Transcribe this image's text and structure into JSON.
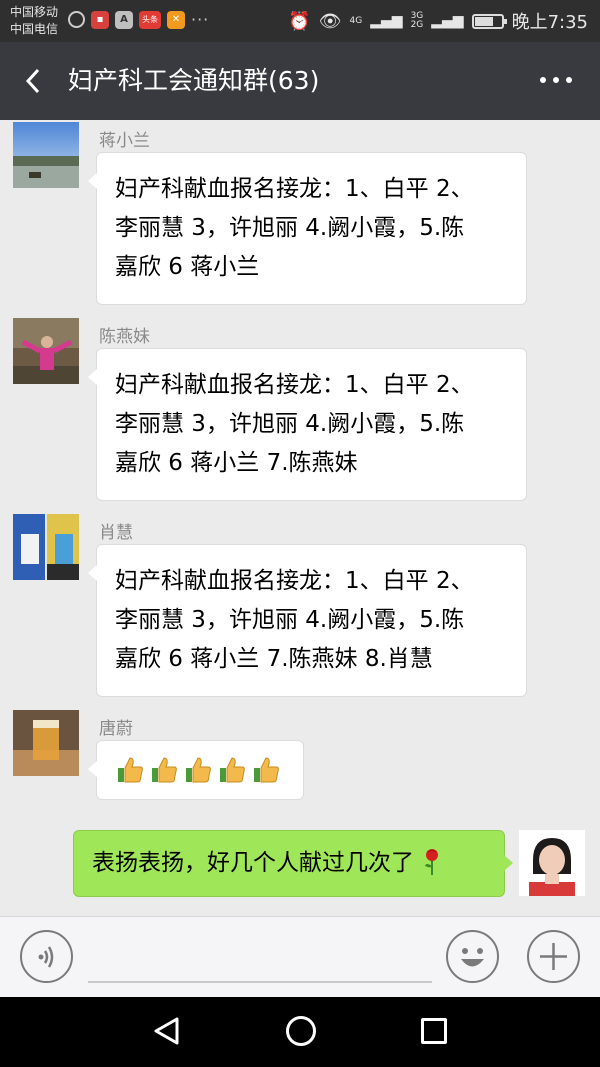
{
  "status_bar": {
    "carrier_1": "中国移动",
    "carrier_2": "中国电信",
    "notification_icons": [
      "wechat-icon",
      "red-app-icon",
      "a-app-icon",
      "toutiao-icon",
      "orange-app-icon"
    ],
    "toutiao_label": "头条",
    "a_label": "A",
    "more_dots": "···",
    "signal_1": "4G",
    "signal_2": "3G\n2G",
    "battery_percent": 70,
    "time": "晚上7:35"
  },
  "title_bar": {
    "title": "妇产科工会通知群(63)"
  },
  "messages": [
    {
      "sender": "蒋小兰",
      "lines": [
        "妇产科献血报名接龙：1、白平 2、",
        "李丽慧 3，许旭丽 4.阙小霞，5.陈",
        "嘉欣 6 蒋小兰"
      ]
    },
    {
      "sender": "陈燕妹",
      "lines": [
        "妇产科献血报名接龙：1、白平 2、",
        "李丽慧 3，许旭丽 4.阙小霞，5.陈",
        "嘉欣 6 蒋小兰 7.陈燕妹"
      ]
    },
    {
      "sender": "肖慧",
      "lines": [
        "妇产科献血报名接龙：1、白平 2、",
        "李丽慧 3，许旭丽 4.阙小霞，5.陈",
        "嘉欣 6 蒋小兰 7.陈燕妹 8.肖慧"
      ]
    },
    {
      "sender": "唐蔚",
      "emoji": [
        "thumbs-up-icon",
        "thumbs-up-icon",
        "thumbs-up-icon",
        "thumbs-up-icon",
        "thumbs-up-icon"
      ]
    }
  ],
  "outgoing": {
    "text": "表扬表扬，好几个人献过几次了",
    "emoji": "rose-icon"
  },
  "colors": {
    "title_bar": "#393a3f",
    "status_bar": "#2f2f2f",
    "chat_bg": "#ebebeb",
    "outgoing_bubble": "#9fe658"
  }
}
